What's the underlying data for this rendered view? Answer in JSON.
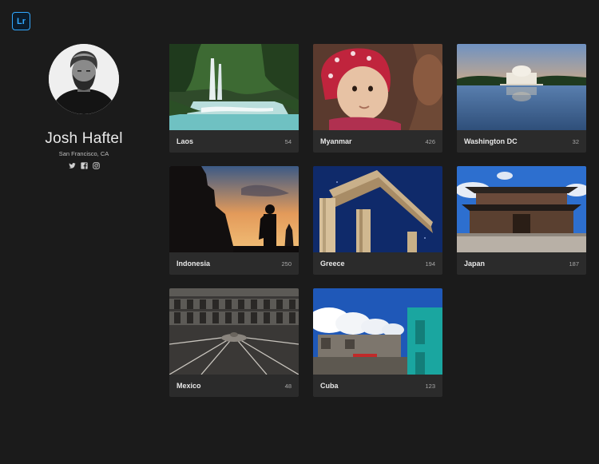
{
  "app": {
    "logo_text": "Lr",
    "accent_color": "#31a8ff"
  },
  "profile": {
    "name": "Josh Haftel",
    "location": "San Francisco, CA",
    "social": [
      "twitter-icon",
      "facebook-icon",
      "instagram-icon"
    ]
  },
  "albums": [
    {
      "title": "Laos",
      "count": "54"
    },
    {
      "title": "Myanmar",
      "count": "426"
    },
    {
      "title": "Washington DC",
      "count": "32"
    },
    {
      "title": "Indonesia",
      "count": "250"
    },
    {
      "title": "Greece",
      "count": "194"
    },
    {
      "title": "Japan",
      "count": "187"
    },
    {
      "title": "Mexico",
      "count": "48"
    },
    {
      "title": "Cuba",
      "count": "123"
    }
  ]
}
